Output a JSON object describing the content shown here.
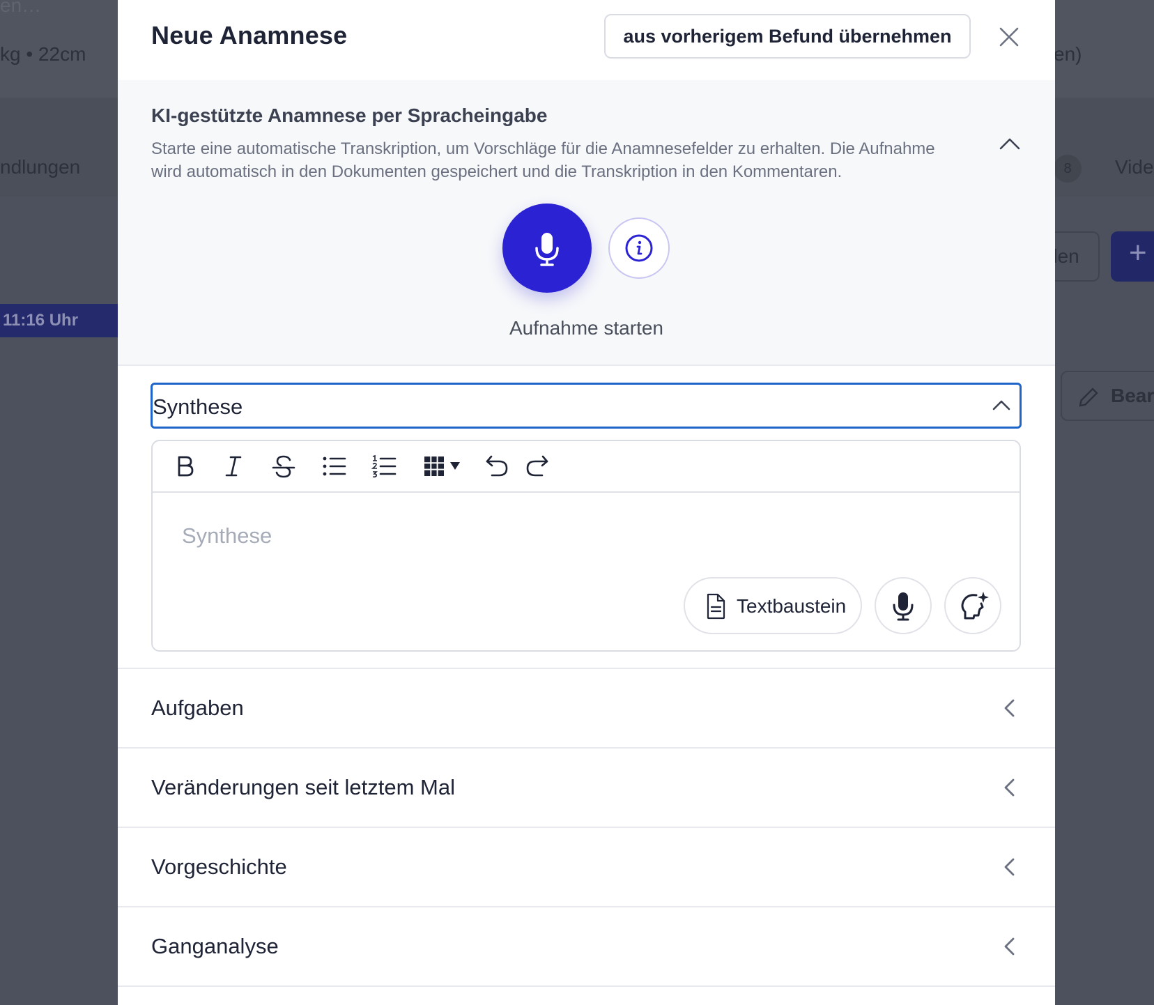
{
  "background": {
    "top_left_fragment": "en…",
    "weight_size": "kg • 22cm",
    "top_right_fragment": "en)",
    "tab_left_fragment": "ndlungen",
    "tab_badge_count": "8",
    "tab_right_fragment": "Vide",
    "time_badge": "11:16 Uhr",
    "button_fragment": "den",
    "plus_symbol": "+",
    "edit_fragment": "Bear"
  },
  "modal": {
    "title": "Neue Anamnese",
    "copy_button_label": "aus vorherigem Befund übernehmen"
  },
  "ai_transcription": {
    "title": "KI-gestützte Anamnese per Spracheingabe",
    "description": "Starte eine automatische Transkription, um Vorschläge für die Anamnesefelder zu erhalten. Die Aufnahme wird automatisch in den Dokumenten gespeichert und die Transkription in den Kommentaren.",
    "record_label": "Aufnahme starten"
  },
  "synthese": {
    "section_label": "Synthese",
    "editor_placeholder": "Synthese",
    "text_block_button": "Textbaustein",
    "toolbar": [
      "bold-icon",
      "italic-icon",
      "strikethrough-icon",
      "bullet-list-icon",
      "numbered-list-icon",
      "table-icon",
      "undo-icon",
      "redo-icon"
    ]
  },
  "sections": [
    {
      "label": "Aufgaben"
    },
    {
      "label": "Veränderungen seit letztem Mal"
    },
    {
      "label": "Vorgeschichte"
    },
    {
      "label": "Ganganalyse"
    }
  ],
  "colors": {
    "accent": "#2a22d3",
    "focus_border": "#1f64c9",
    "overlay": "#4c515d"
  }
}
